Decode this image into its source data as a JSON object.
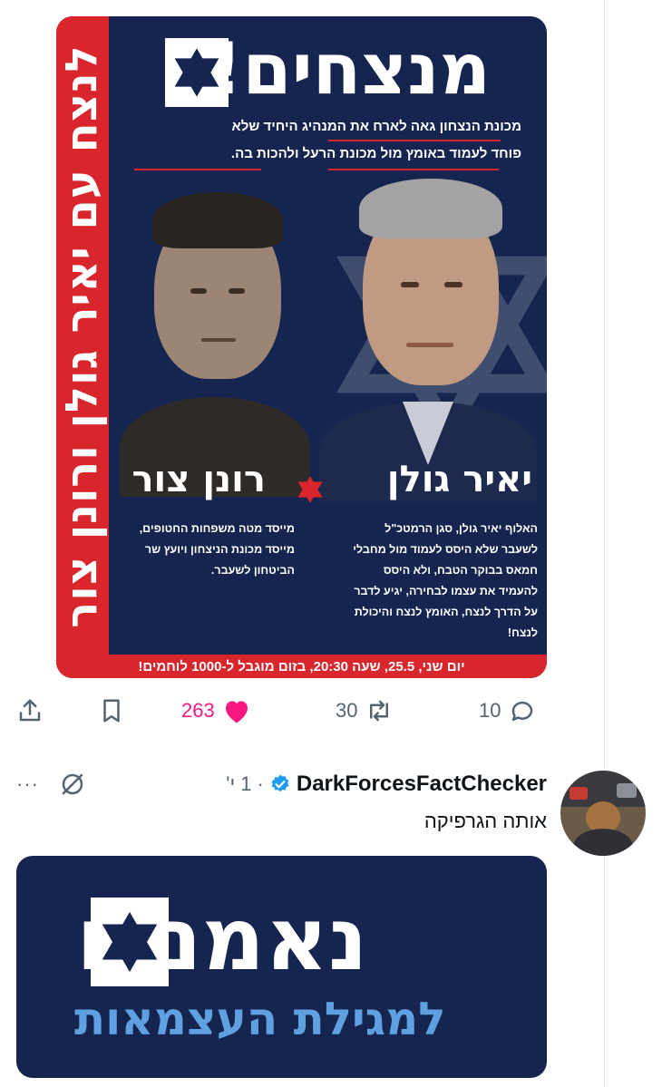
{
  "poster": {
    "headline": "מנצחים!",
    "sub_line_1": "מכונת הנצחון גאה לארח את המנהיג היחיד שלא",
    "sub_line_2": "פוחד לעמוד באומץ מול מכונת הרעל ולהכות בה.",
    "side_banner": "לנצח עם יאיר גולן ורונן צור",
    "person_right_name": "יאיר גולן",
    "person_left_name": "רונן צור",
    "person_right_bio": [
      "האלוף יאיר גולן, סגן הרמטכ\"ל",
      "לשעבר שלא היסס לעמוד מול מחבלי",
      "חמאס בבוקר הטבח, ולא היסס",
      "להעמיד את עצמו לבחירה, יגיע לדבר",
      "על הדרך לנצח, האומץ לנצח והיכולת",
      "לנצח!"
    ],
    "person_left_bio": [
      "מייסד מטה משפחות החטופים,",
      "מייסד מכונת הניצחון ויועץ שר",
      "הביטחון לשעבר."
    ],
    "bottom_strip": "יום שני, 25.5, שעה 20:30, בזום מוגבל ל-1000 לוחמים!",
    "colors": {
      "navy": "#15254f",
      "red": "#d9252c"
    }
  },
  "actions": {
    "likes": "263",
    "retweets": "30",
    "replies": "10",
    "like_color": "#f91880"
  },
  "reply": {
    "user_name": "DarkForcesFactChecker",
    "verified": true,
    "time": "1 י'",
    "separator": "·",
    "text": "אותה הגרפיקה",
    "more": "···"
  },
  "card2": {
    "headline": "נאמנים",
    "subline": "למגילת העצמאות"
  }
}
